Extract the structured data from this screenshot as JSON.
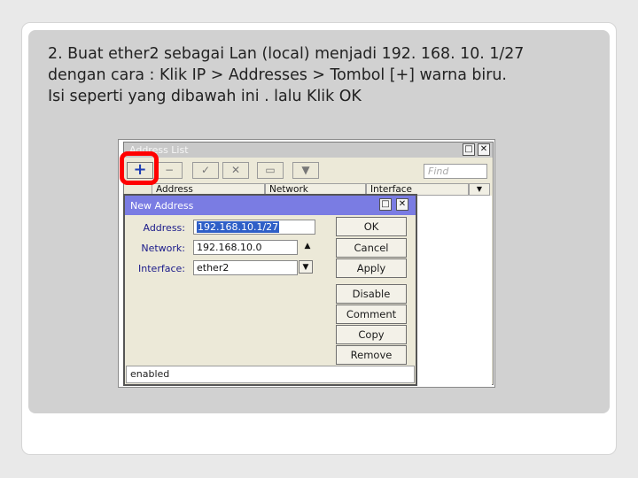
{
  "slide": {
    "instruction_lines": [
      "2. Buat ether2 sebagai Lan (local) menjadi 192. 168. 10. 1/27",
      "dengan cara : Klik IP > Addresses > Tombol [+] warna biru.",
      "Isi seperti yang dibawah ini . lalu Klik OK"
    ]
  },
  "address_list": {
    "title": "Address List",
    "toolbar": {
      "add": "+",
      "remove": "−",
      "enable": "✓",
      "disable": "✕",
      "comment": "▭",
      "filter": "▼",
      "find_placeholder": "Find"
    },
    "columns": [
      "Address",
      "Network",
      "Interface"
    ],
    "window_controls": [
      "□",
      "✕"
    ]
  },
  "new_address": {
    "title": "New Address",
    "window_controls": [
      "□",
      "✕"
    ],
    "fields": {
      "address_label": "Address:",
      "address_value": "192.168.10.1/27",
      "network_label": "Network:",
      "network_value": "192.168.10.0",
      "interface_label": "Interface:",
      "interface_value": "ether2"
    },
    "buttons": [
      "OK",
      "Cancel",
      "Apply",
      "Disable",
      "Comment",
      "Copy",
      "Remove"
    ],
    "status": "enabled"
  },
  "colors": {
    "dialog_title_bar": "#7a7ce3",
    "selection": "#2f5fc7",
    "highlight_mark": "#ff0000",
    "add_button": "#1f3fb5"
  }
}
